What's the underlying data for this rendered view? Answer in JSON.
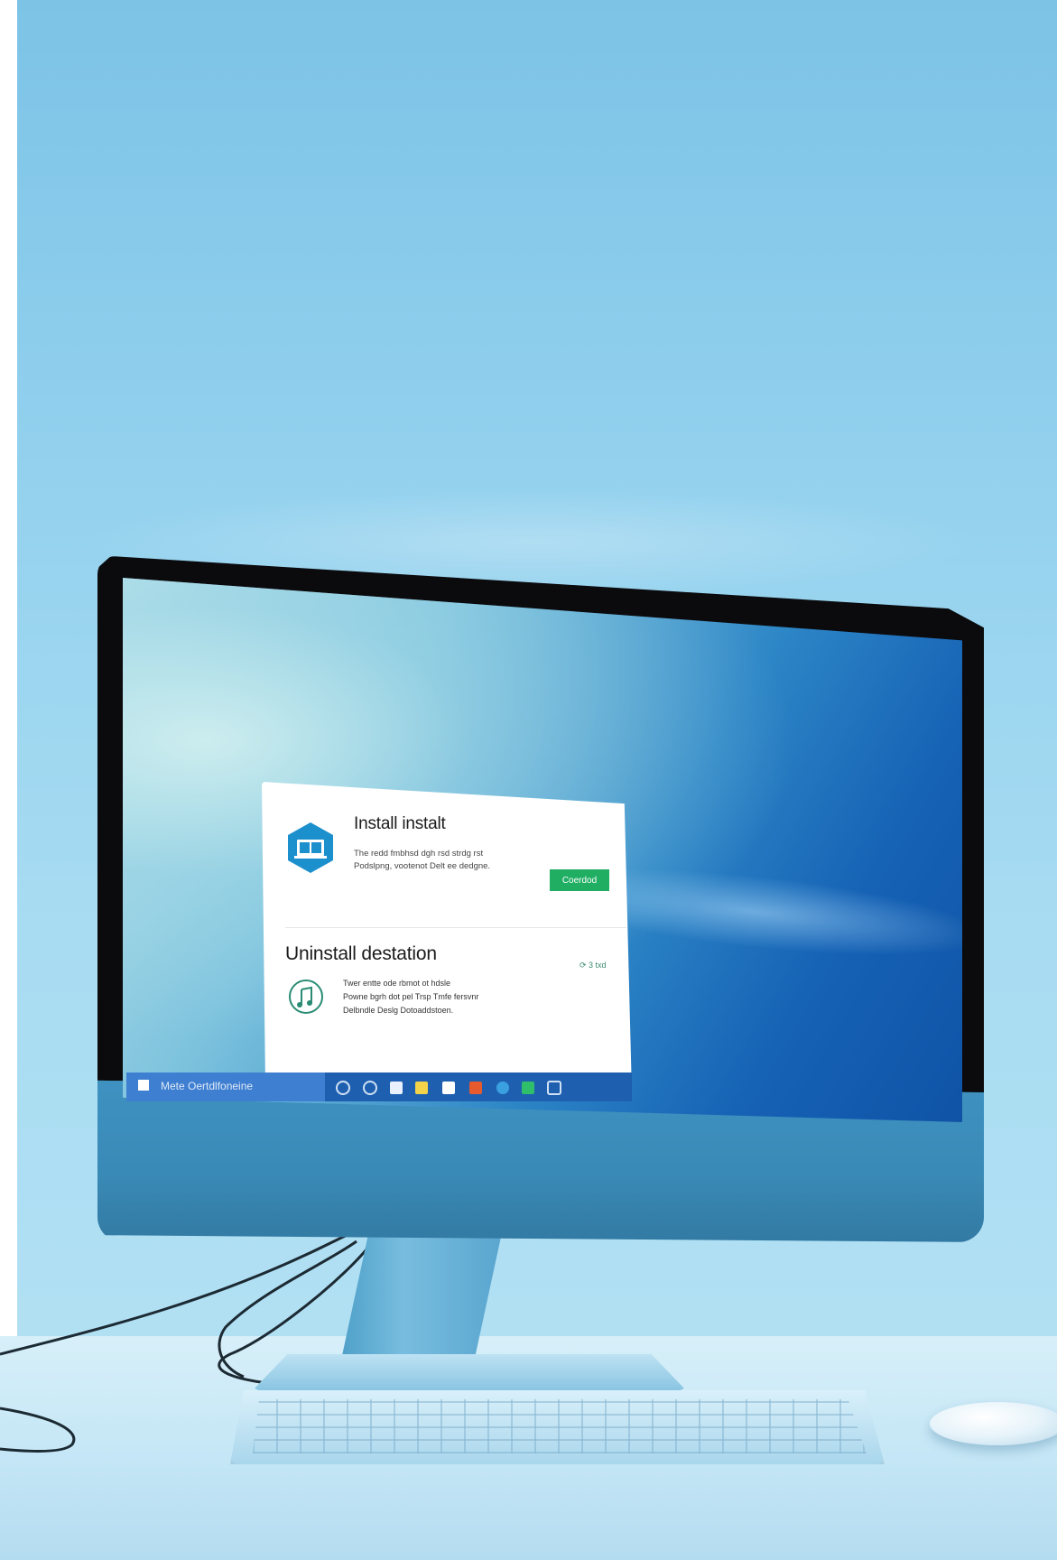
{
  "dialog": {
    "install_title": "Install instalt",
    "install_text_line1": "The redd fmbhsd dgh rsd strdg rst",
    "install_text_line2": "Podslpng, vootenot Delt ee dedgne.",
    "install_button_label": "Coerdod",
    "uninstall_heading": "Uninstall destation",
    "uninstall_status": "⟳ 3 txd",
    "uninstall_text_line1": "Twer entte ode rbmot ot hdsle",
    "uninstall_text_line2": "Powne bgrh dot pel Trsp Tmfe fersvnr",
    "uninstall_text_line3": "Delbndle Deslg Dotoaddstoen."
  },
  "taskbar": {
    "search_text": "Mete Oertdlfoneine"
  },
  "colors": {
    "install_button": "#1fae62",
    "taskbar": "#1e5fb0",
    "app_icon": "#1c8fcd"
  }
}
